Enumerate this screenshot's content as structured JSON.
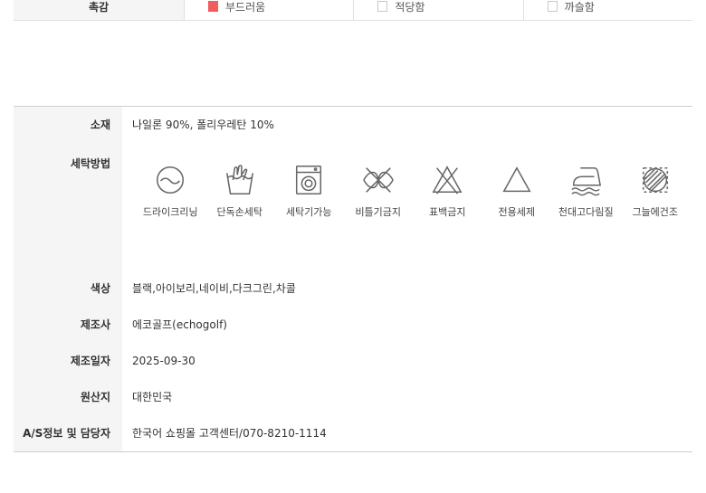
{
  "top_row": {
    "header": "촉감",
    "options": [
      {
        "label": "부드러움",
        "checked": true
      },
      {
        "label": "적당함",
        "checked": false
      },
      {
        "label": "까슬함",
        "checked": false
      }
    ]
  },
  "spec": {
    "material": {
      "label": "소재",
      "value": "나일론 90%, 폴리우레탄 10%"
    },
    "washing": {
      "label": "세탁방법",
      "items": [
        {
          "icon": "dry-clean-icon",
          "caption": "드라이크리닝"
        },
        {
          "icon": "hand-wash-icon",
          "caption": "단독손세탁"
        },
        {
          "icon": "washing-machine-icon",
          "caption": "세탁기가능"
        },
        {
          "icon": "no-wring-icon",
          "caption": "비틀기금지"
        },
        {
          "icon": "no-bleach-icon",
          "caption": "표백금지"
        },
        {
          "icon": "neutral-detergent-icon",
          "caption": "전용세제"
        },
        {
          "icon": "iron-cloth-icon",
          "caption": "천대고다림질"
        },
        {
          "icon": "shade-dry-icon",
          "caption": "그늘에건조"
        }
      ]
    },
    "color": {
      "label": "색상",
      "value": "블랙,아이보리,네이비,다크그린,차콜"
    },
    "manufacturer": {
      "label": "제조사",
      "value": "에코골프(echogolf)"
    },
    "mfg_date": {
      "label": "제조일자",
      "value": "2025-09-30"
    },
    "origin": {
      "label": "원산지",
      "value": "대한민국"
    },
    "as_info": {
      "label": "A/S정보 및 담당자",
      "value": "한국어 쇼핑몰 고객센터/070-8210-1114"
    }
  },
  "colors": {
    "checked": "#f25c5c",
    "label_bg": "#f5f5f5",
    "icon_stroke": "#666666"
  }
}
